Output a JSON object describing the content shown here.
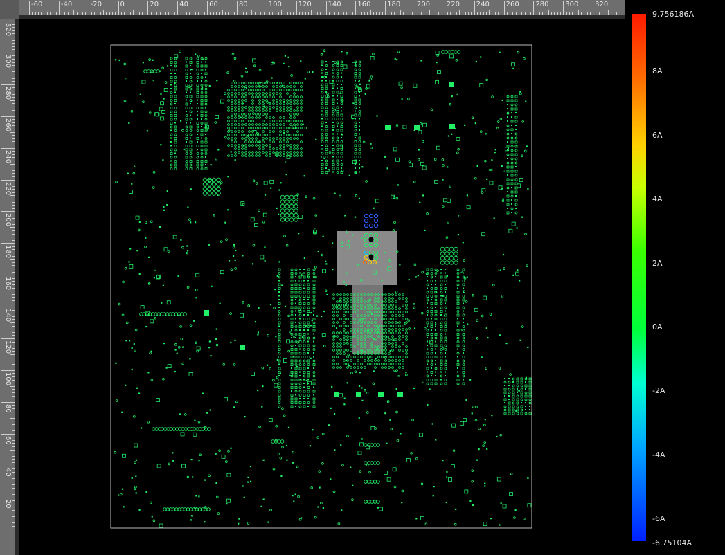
{
  "rulers": {
    "top_labels": [
      "-60",
      "-40",
      "-20",
      "0",
      "20",
      "40",
      "60",
      "80",
      "100",
      "120",
      "140",
      "160",
      "180",
      "200",
      "220",
      "240",
      "260",
      "280",
      "300",
      "320"
    ],
    "left_labels": [
      "320",
      "300",
      "280",
      "260",
      "240",
      "220",
      "200",
      "180",
      "160",
      "140",
      "120",
      "100",
      "80",
      "60",
      "40",
      "20"
    ]
  },
  "colorbar": {
    "max_label": "9.756186A",
    "labels": [
      "8A",
      "6A",
      "4A",
      "2A",
      "0A",
      "-2A",
      "-4A",
      "-6A"
    ],
    "min_label": "-6.75104A",
    "colors": {
      "high": "#ff1a00",
      "mid": "#00ff3c",
      "low": "#0020ff"
    }
  },
  "board": {
    "trace_color": "#22ee66",
    "highlight_color": "#8a8a8a",
    "outline_color": "#bdbdbd"
  }
}
